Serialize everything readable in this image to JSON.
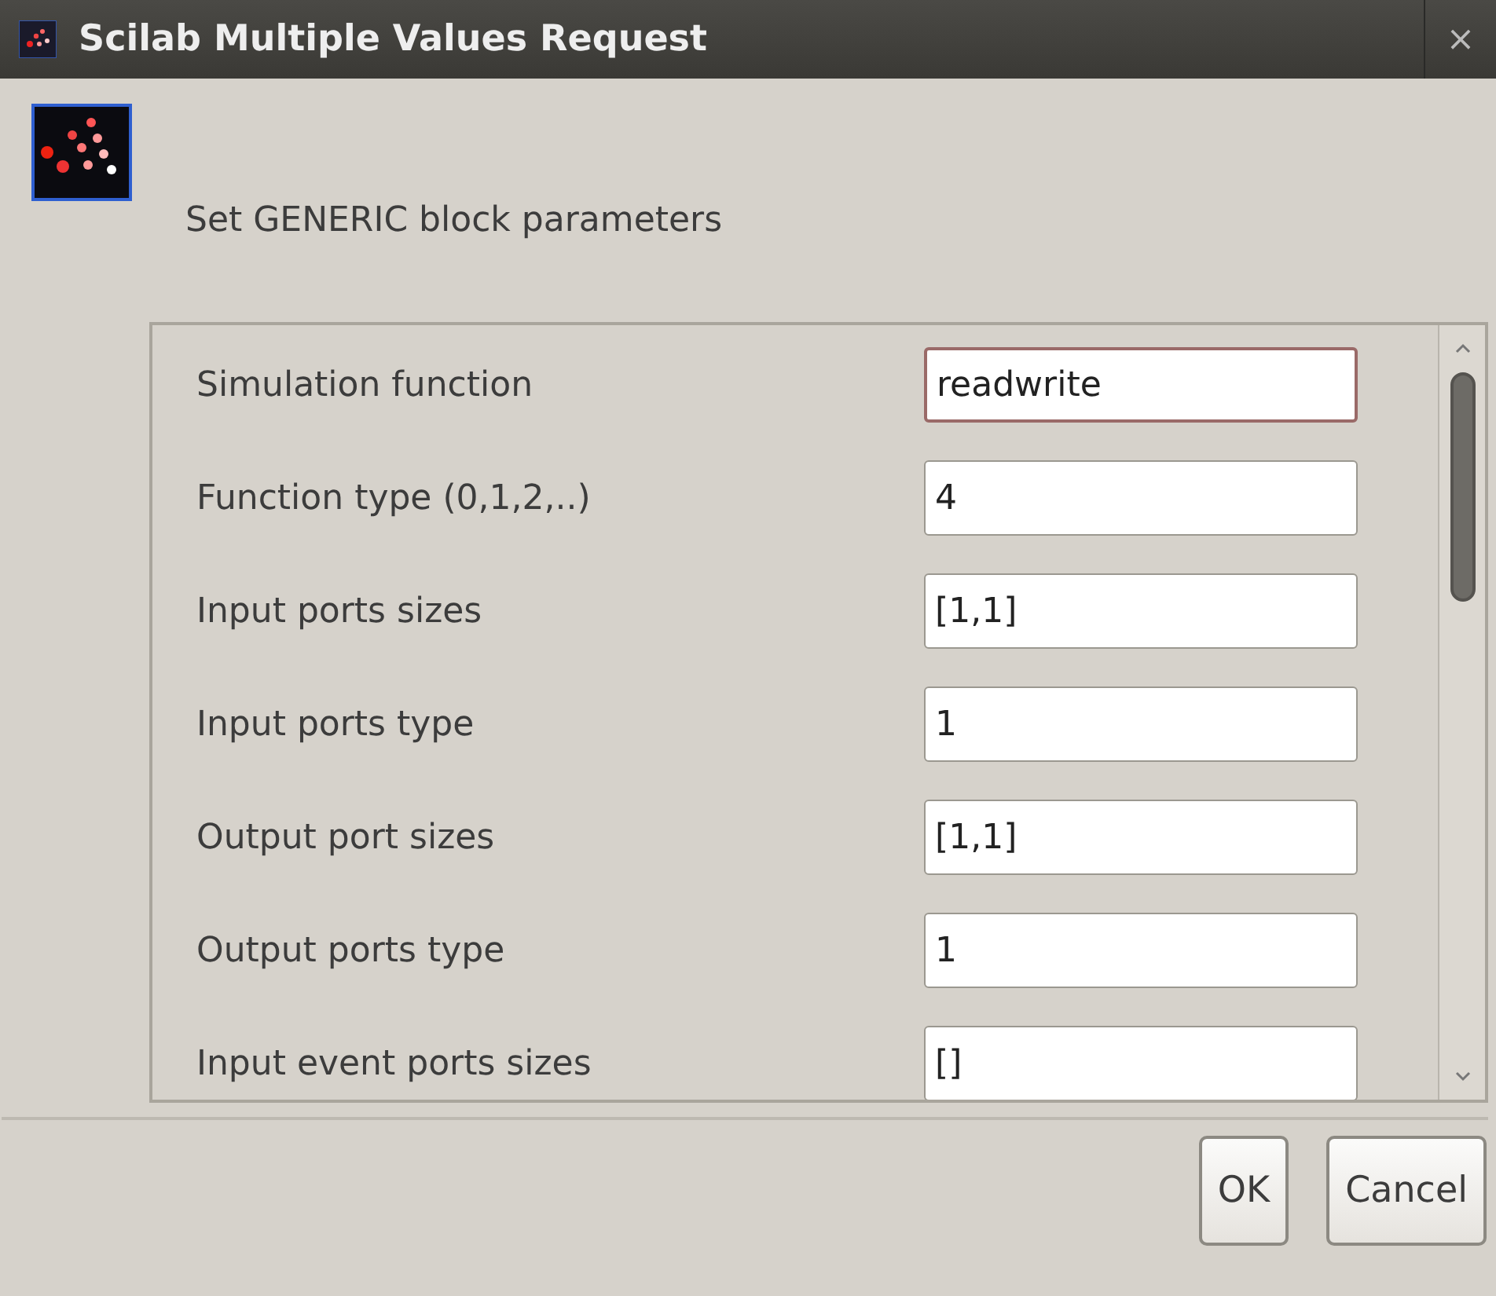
{
  "window": {
    "title": "Scilab Multiple Values Request",
    "close": "×"
  },
  "message": "Set GENERIC block parameters",
  "fields": [
    {
      "label": "Simulation function",
      "value": "readwrite",
      "focused": true
    },
    {
      "label": "Function type (0,1,2,..)",
      "value": "4",
      "focused": false
    },
    {
      "label": "Input ports sizes",
      "value": "[1,1]",
      "focused": false
    },
    {
      "label": "Input ports type",
      "value": "1",
      "focused": false
    },
    {
      "label": "Output port sizes",
      "value": "[1,1]",
      "focused": false
    },
    {
      "label": "Output ports type",
      "value": "1",
      "focused": false
    },
    {
      "label": "Input event ports sizes",
      "value": "[]",
      "focused": false
    }
  ],
  "buttons": [
    {
      "label": "OK"
    },
    {
      "label": "Cancel"
    }
  ]
}
